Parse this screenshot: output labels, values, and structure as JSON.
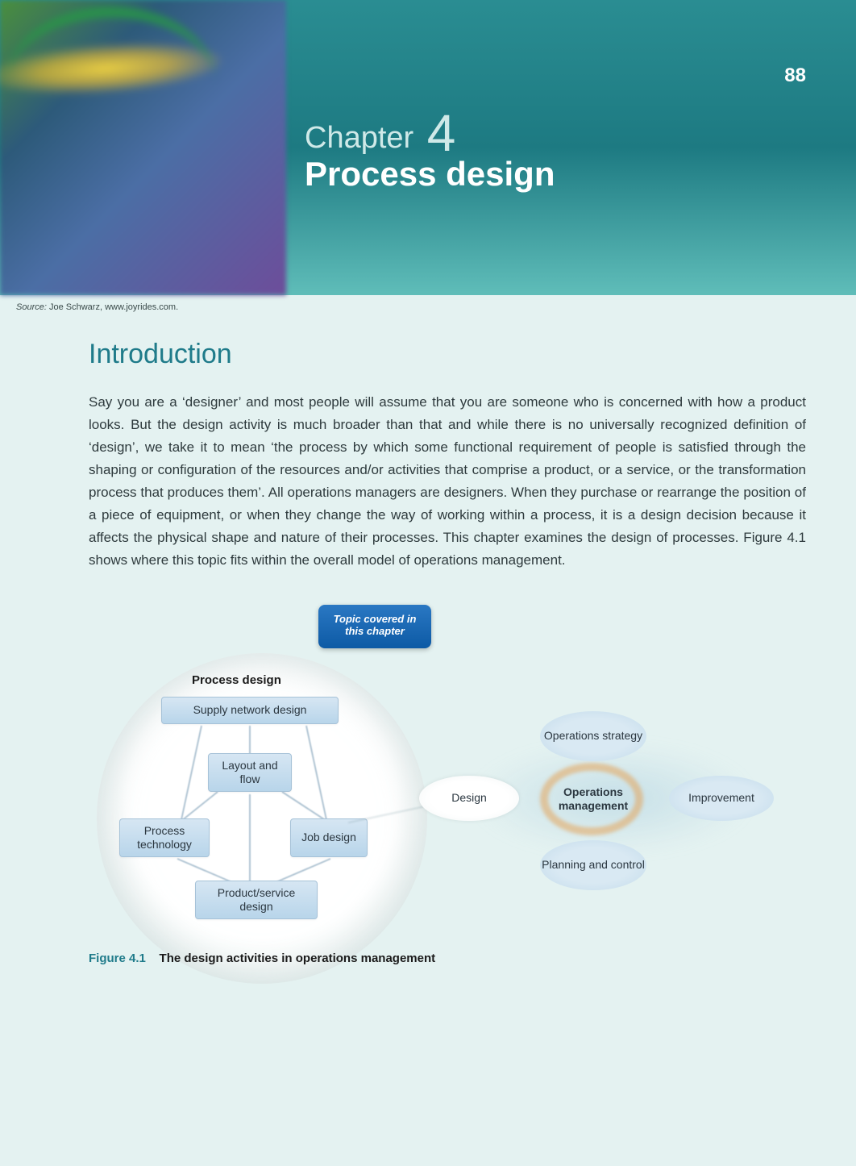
{
  "page_number": "88",
  "chapter_label": "Chapter",
  "chapter_number": "4",
  "chapter_title": "Process design",
  "source": {
    "label": "Source:",
    "text": "Joe Schwarz, www.joyrides.com."
  },
  "intro": {
    "heading": "Introduction",
    "body": "Say you are a ‘designer’ and most people will assume that you are someone who is concerned with how a product looks. But the design activity is much broader than that and while there is no universally recognized definition of ‘design’, we take it to mean ‘the process by which some functional requirement of people is satisfied through the shaping or configuration of the resources and/or activities that comprise a product, or a service, or the transformation process that produces them’. All operations managers are designers. When they purchase or rearrange the position of a piece of equipment, or when they change the way of working within a process, it is a design decision because it affects the physical shape and nature of their processes. This chapter examines the design of processes. Figure 4.1 shows where this topic fits within the overall model of operations management."
  },
  "figure": {
    "topic_badge": "Topic covered in this chapter",
    "left_title": "Process design",
    "left_nodes": {
      "supply": "Supply network design",
      "layout": "Layout and flow",
      "process_tech": "Process technology",
      "job": "Job design",
      "product": "Product/service design"
    },
    "right_nodes": {
      "ops_strategy": "Operations strategy",
      "improvement": "Improvement",
      "planning": "Planning and control",
      "design": "Design",
      "operations_management": "Operations management"
    },
    "caption_num": "Figure 4.1",
    "caption_title": "The design activities in operations management"
  },
  "chart_data": {
    "type": "diagram",
    "title": "The design activities in operations management",
    "left_cluster": {
      "label": "Process design",
      "highlighted_as": "Topic covered in this chapter",
      "nodes": [
        "Supply network design",
        "Layout and flow",
        "Process technology",
        "Job design",
        "Product/service design"
      ],
      "edges": [
        [
          "Supply network design",
          "Layout and flow"
        ],
        [
          "Supply network design",
          "Process technology"
        ],
        [
          "Supply network design",
          "Job design"
        ],
        [
          "Layout and flow",
          "Process technology"
        ],
        [
          "Layout and flow",
          "Job design"
        ],
        [
          "Process technology",
          "Product/service design"
        ],
        [
          "Job design",
          "Product/service design"
        ],
        [
          "Layout and flow",
          "Product/service design"
        ]
      ]
    },
    "right_cluster": {
      "center": "Operations management",
      "around": [
        "Operations strategy",
        "Improvement",
        "Planning and control",
        "Design"
      ],
      "active": "Design"
    },
    "link": [
      "Process design (left cluster)",
      "Design (right cluster)"
    ]
  }
}
